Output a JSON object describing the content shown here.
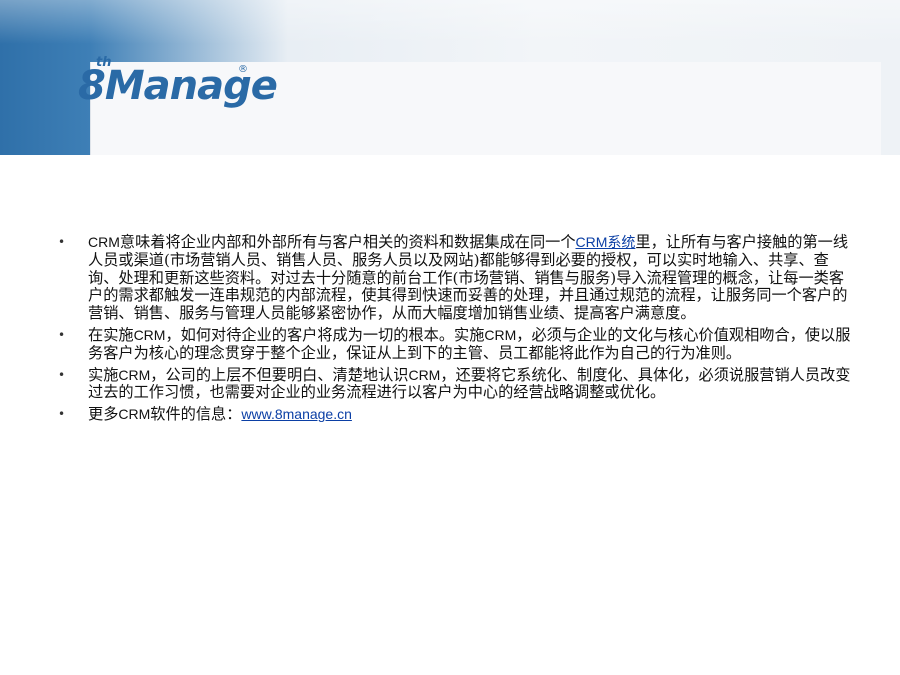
{
  "header": {
    "logo_super": "th",
    "logo_text": "8Manage",
    "logo_reg": "®"
  },
  "bullet_symbol": "•",
  "items": [
    {
      "p1": "CRM",
      "p2": "意味着将企业内部和外部所有与客户相关的资料和数据集成在同一个",
      "p3": "CRM系统",
      "p4": "里，让所有与客户接触的第一线人员或渠道(市场营销人员、销售人员、服务人员以及网站)都能够得到必要的授权，可以实时地输入、共享、查询、处理和更新这些资料。对过去十分随意的前台工作(市场营销、销售与服务)导入流程管理的概念，让每一类客户的需求都触发一连串规范的内部流程，使其得到快速而妥善的处理，并且通过规范的流程，让服务同一个客户的营销、销售、服务与管理人员能够紧密协作，从而大幅度增加销售业绩、提高客户满意度。"
    },
    {
      "p1": "在实施",
      "p2": "CRM",
      "p3": "，如何对待企业的客户将成为一切的根本。实施",
      "p4": "CRM",
      "p5": "，必须与企业的文化与核心价值观相吻合，使以服务客户为核心的理念贯穿于整个企业，保证从上到下的主管、员工都能将此作为自己的行为准则。"
    },
    {
      "p1": "实施",
      "p2": "CRM",
      "p3": "，公司的上层不但要明白、清楚地认识",
      "p4": "CRM",
      "p5": "，还要将它系统化、制度化、具体化，必须说服营销人员改变过去的工作习惯，也需要对企业的业务流程进行以客户为中心的经营战略调整或优化。"
    },
    {
      "p1": "更多",
      "p2": "CRM",
      "p3": "软件的信息：",
      "link": "www.8manage.cn"
    }
  ]
}
